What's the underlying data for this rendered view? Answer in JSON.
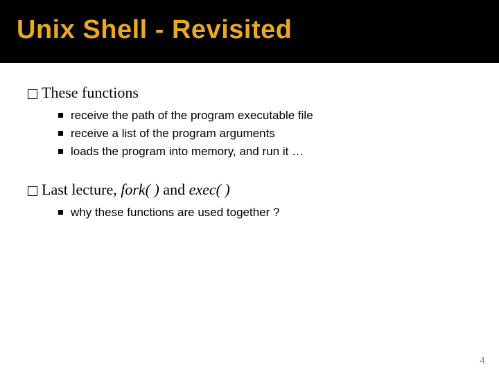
{
  "title": "Unix Shell - Revisited",
  "section1": {
    "heading": "These functions",
    "bullets": [
      "receive the path of the program executable file",
      "receive a list of the program arguments",
      "loads the program into memory, and run it …"
    ]
  },
  "section2": {
    "heading_prefix": "Last lecture,  ",
    "fork": "fork( )",
    "and": " and ",
    "exec": "exec( )",
    "bullets": [
      "why these functions are used together ?"
    ]
  },
  "page_number": "4"
}
